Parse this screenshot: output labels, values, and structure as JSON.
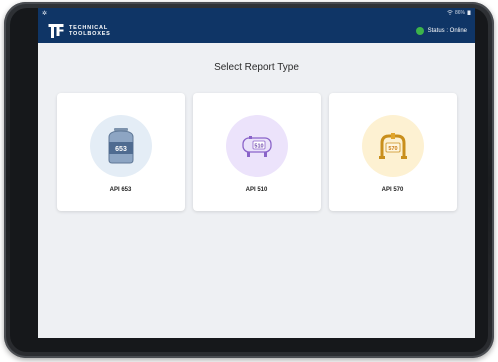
{
  "status_bar": {
    "left_icon": "gear-icon",
    "wifi_icon": "wifi-icon",
    "battery_text": "86%",
    "battery_icon": "battery-icon"
  },
  "header": {
    "logo_line1": "TECHNICAL",
    "logo_line2": "TOOLBOXES",
    "status_text": "Status : Online",
    "status_color": "#3cb34a",
    "brand_color": "#0f3566"
  },
  "main": {
    "title": "Select Report Type",
    "cards": [
      {
        "label": "API 653",
        "icon_text": "653",
        "icon": "storage-tank-icon",
        "circle_color": "#e4edf6"
      },
      {
        "label": "API 510",
        "icon_text": "510",
        "icon": "pressure-vessel-icon",
        "circle_color": "#ece3fb"
      },
      {
        "label": "API 570",
        "icon_text": "570",
        "icon": "piping-icon",
        "circle_color": "#fdf1d2"
      }
    ]
  }
}
